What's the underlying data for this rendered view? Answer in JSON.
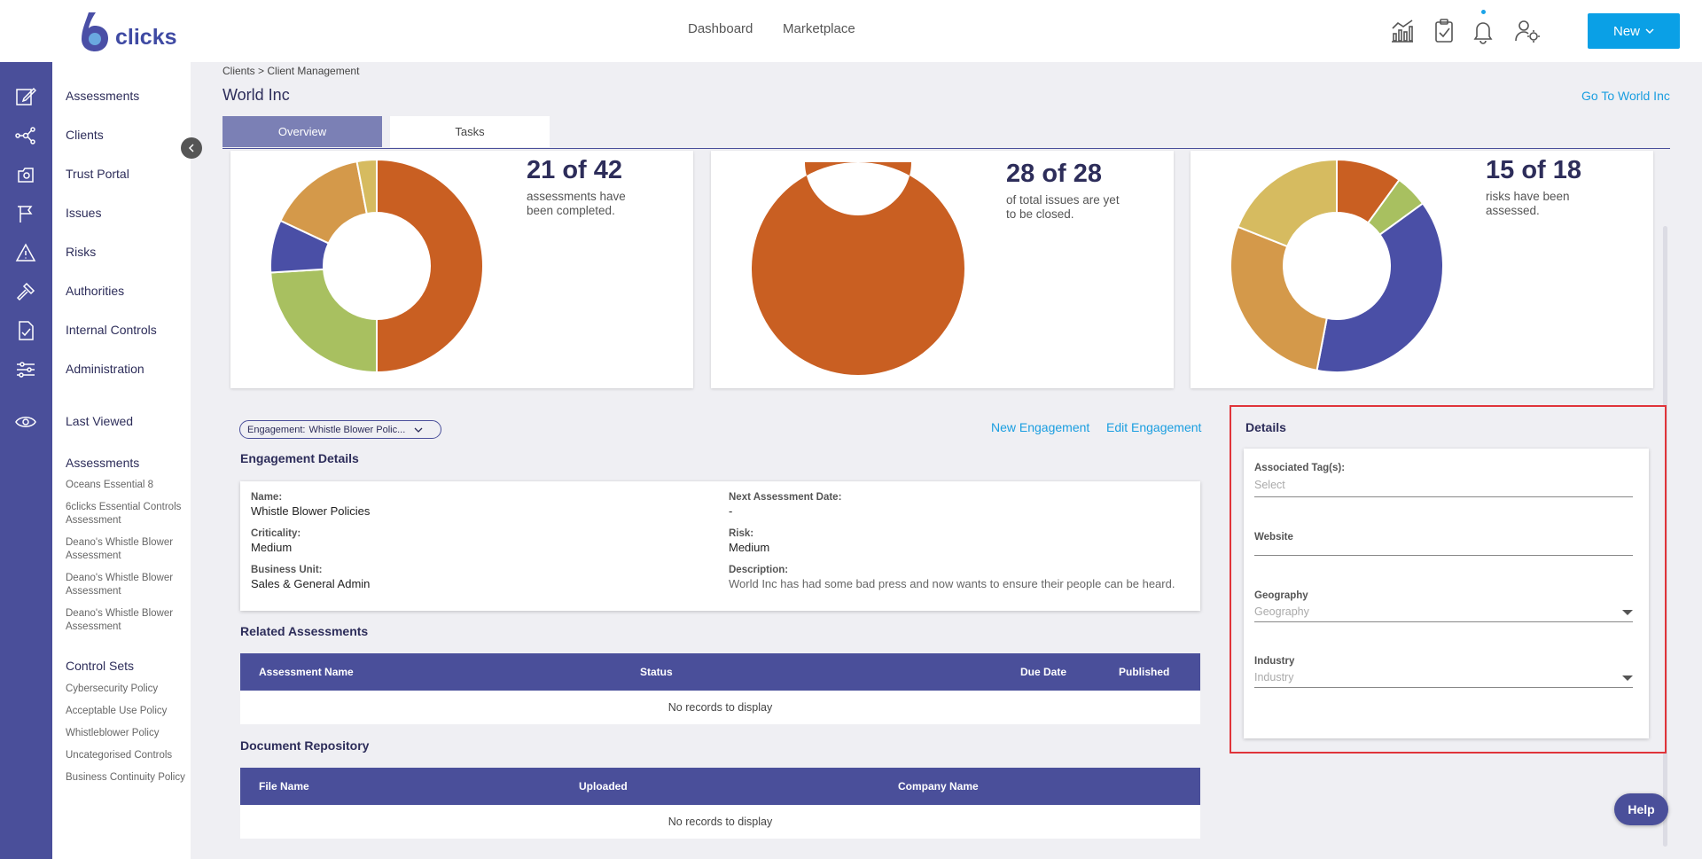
{
  "app": {
    "logo_text": "clicks"
  },
  "topnav": {
    "dashboard": "Dashboard",
    "marketplace": "Marketplace",
    "new_label": "New"
  },
  "icons": {
    "top": [
      "analytics-icon",
      "clipboard-check-icon",
      "bell-icon",
      "user-settings-icon"
    ],
    "rail": [
      "edit-icon",
      "network-icon",
      "portal-icon",
      "issues-icon",
      "warning-icon",
      "hammer-icon",
      "document-check-icon",
      "sliders-icon",
      "eye-icon"
    ]
  },
  "sidebar": {
    "items": [
      "Assessments",
      "Clients",
      "Trust Portal",
      "Issues",
      "Risks",
      "Authorities",
      "Internal Controls",
      "Administration"
    ],
    "last_viewed": "Last Viewed",
    "assessments_heading": "Assessments",
    "assessments": [
      "Oceans Essential 8",
      "6clicks Essential Controls Assessment",
      "Deano's Whistle Blower Assessment",
      "Deano's Whistle Blower Assessment",
      "Deano's Whistle Blower Assessment"
    ],
    "control_sets_heading": "Control Sets",
    "control_sets": [
      "Cybersecurity Policy",
      "Acceptable Use Policy",
      "Whistleblower Policy",
      "Uncategorised Controls",
      "Business Continuity Policy"
    ]
  },
  "header": {
    "breadcrumb": "Clients >  Client Management",
    "title": "World Inc",
    "goto_link": "Go To World Inc",
    "tabs": [
      "Overview",
      "Tasks"
    ]
  },
  "cards": [
    {
      "stat": "21 of 42",
      "text": "assessments have been completed."
    },
    {
      "stat": "28 of 28",
      "text": "of total issues are yet to be closed."
    },
    {
      "stat": "15 of 18",
      "text": "risks have been assessed."
    }
  ],
  "chart_data": [
    {
      "type": "pie",
      "name": "assessments",
      "slices": [
        {
          "value": 50,
          "color": "#c95f22"
        },
        {
          "value": 24,
          "color": "#a8c060"
        },
        {
          "value": 8,
          "color": "#4a4fa6"
        },
        {
          "value": 15,
          "color": "#d4994a"
        },
        {
          "value": 3,
          "color": "#d6bb60"
        }
      ]
    },
    {
      "type": "pie",
      "name": "issues",
      "slices": [
        {
          "value": 100,
          "color": "#c95f22"
        }
      ]
    },
    {
      "type": "pie",
      "name": "risks",
      "slices": [
        {
          "value": 10,
          "color": "#c95f22"
        },
        {
          "value": 5,
          "color": "#a8c060"
        },
        {
          "value": 38,
          "color": "#4a4fa6"
        },
        {
          "value": 28,
          "color": "#d4994a"
        },
        {
          "value": 19,
          "color": "#d6bb60"
        }
      ]
    }
  ],
  "engagement": {
    "pill_label": "Engagement:",
    "pill_value": "Whistle Blower Polic...",
    "new_link": "New Engagement",
    "edit_link": "Edit Engagement",
    "section_title": "Engagement Details",
    "name_label": "Name:",
    "name_value": "Whistle Blower Policies",
    "criticality_label": "Criticality:",
    "criticality_value": "Medium",
    "bu_label": "Business Unit:",
    "bu_value": "Sales & General Admin",
    "next_label": "Next Assessment Date:",
    "next_value": "-",
    "risk_label": "Risk:",
    "risk_value": "Medium",
    "desc_label": "Description:",
    "desc_value": "World Inc has had some bad press and now wants to ensure their people can be heard."
  },
  "related": {
    "title": "Related Assessments",
    "columns": [
      "Assessment Name",
      "Status",
      "Due Date",
      "Published"
    ],
    "empty": "No records to display"
  },
  "documents": {
    "title": "Document Repository",
    "columns": [
      "File Name",
      "Uploaded",
      "Company Name"
    ],
    "empty": "No records to display"
  },
  "details": {
    "title": "Details",
    "tags_label": "Associated Tag(s):",
    "tags_placeholder": "Select",
    "website_label": "Website",
    "geo_label": "Geography",
    "geo_placeholder": "Geography",
    "industry_label": "Industry",
    "industry_placeholder": "Industry"
  },
  "help": "Help",
  "colors": {
    "accent": "#0aa0e6",
    "rail": "#4a4f9a",
    "highlight": "#e0343a"
  }
}
